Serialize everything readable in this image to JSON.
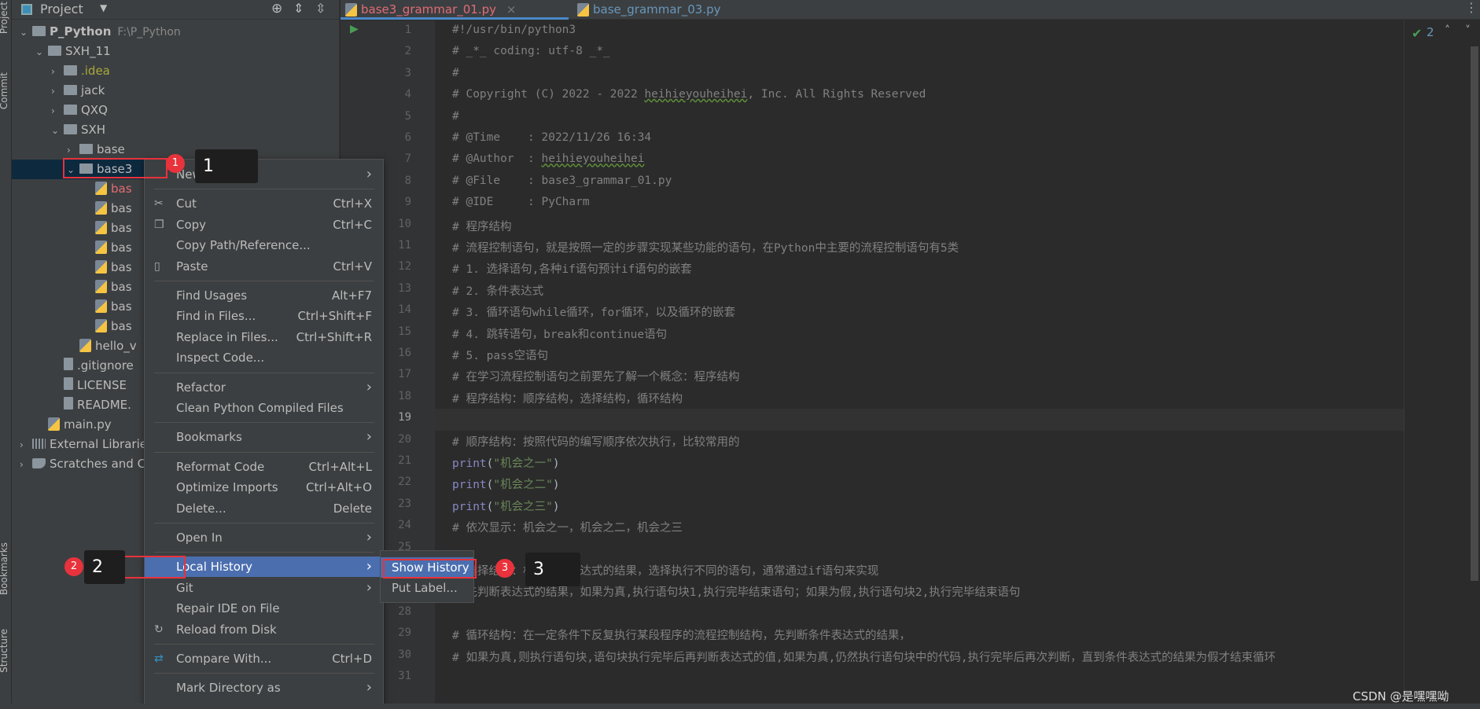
{
  "left_stripe": [
    "Project",
    "Commit",
    "Bookmarks",
    "Structure"
  ],
  "project_panel": {
    "title": "Project",
    "toolbar_icons": [
      "locate-icon",
      "expand-all-icon",
      "collapse-all-icon",
      "gear-icon",
      "minimize-icon"
    ],
    "tree": [
      {
        "label": "P_Python",
        "hint": "F:\\P_Python",
        "level": 0,
        "type": "folder",
        "expanded": true,
        "bold": true
      },
      {
        "label": "SXH_11",
        "level": 1,
        "type": "folder",
        "expanded": true
      },
      {
        "label": ".idea",
        "level": 2,
        "type": "folder",
        "expanded": false,
        "color": "#a9a93c"
      },
      {
        "label": "jack",
        "level": 2,
        "type": "folder",
        "expanded": false
      },
      {
        "label": "QXQ",
        "level": 2,
        "type": "folder",
        "expanded": false
      },
      {
        "label": "SXH",
        "level": 2,
        "type": "folder",
        "expanded": true
      },
      {
        "label": "base",
        "level": 3,
        "type": "folder",
        "expanded": false
      },
      {
        "label": "base3",
        "level": 3,
        "type": "folder",
        "expanded": true,
        "selected": true
      },
      {
        "label": "bas",
        "level": 4,
        "type": "py",
        "color": "#e06c75"
      },
      {
        "label": "bas",
        "level": 4,
        "type": "py"
      },
      {
        "label": "bas",
        "level": 4,
        "type": "py"
      },
      {
        "label": "bas",
        "level": 4,
        "type": "py"
      },
      {
        "label": "bas",
        "level": 4,
        "type": "py"
      },
      {
        "label": "bas",
        "level": 4,
        "type": "py"
      },
      {
        "label": "bas",
        "level": 4,
        "type": "py"
      },
      {
        "label": "bas",
        "level": 4,
        "type": "py"
      },
      {
        "label": "hello_v",
        "level": 3,
        "type": "py"
      },
      {
        "label": ".gitignore",
        "level": 2,
        "type": "file"
      },
      {
        "label": "LICENSE",
        "level": 2,
        "type": "file"
      },
      {
        "label": "README.",
        "level": 2,
        "type": "md"
      },
      {
        "label": "main.py",
        "level": 1,
        "type": "py"
      },
      {
        "label": "External Librarie",
        "level": 0,
        "type": "lib",
        "expanded": false
      },
      {
        "label": "Scratches and C",
        "level": 0,
        "type": "scratch",
        "expanded": false
      }
    ]
  },
  "tabs": [
    {
      "label": "base3_grammar_01.py",
      "active": true,
      "color": "#e06c75"
    },
    {
      "label": "base_grammar_03.py",
      "active": false,
      "color": "#6897bb"
    }
  ],
  "inspections": {
    "count": "2",
    "color": "#499c54"
  },
  "code_lines": [
    "#!/usr/bin/python3",
    "# _*_ coding: utf-8 _*_",
    "#",
    "# Copyright (C) 2022 - 2022 heihieyouheihei, Inc. All Rights Reserved",
    "#",
    "# @Time    : 2022/11/26 16:34",
    "# @Author  : heihieyouheihei",
    "# @File    : base3_grammar_01.py",
    "# @IDE     : PyCharm",
    "# 程序结构",
    "# 流程控制语句，就是按照一定的步骤实现某些功能的语句，在Python中主要的流程控制语句有5类",
    "# 1. 选择语句,各种if语句预计if语句的嵌套",
    "# 2. 条件表达式",
    "# 3. 循环语句while循环，for循环，以及循环的嵌套",
    "# 4. 跳转语句，break和continue语句",
    "# 5. pass空语句",
    "# 在学习流程控制语句之前要先了解一个概念：程序结构",
    "# 程序结构：顺序结构，选择结构，循环结构",
    "",
    "# 顺序结构：按照代码的编写顺序依次执行，比较常用的",
    "print(\"机会之一\")",
    "print(\"机会之二\")",
    "print(\"机会之三\")",
    "# 依次显示：机会之一，机会之二，机会之三",
    "",
    "# 选择结构：根据条件表达式的结果，选择执行不同的语句，通常通过if语句来实现",
    "# 先判断表达式的结果，如果为真,执行语句块1,执行完毕结束语句；如果为假,执行语句块2,执行完毕结束语句",
    "",
    "# 循环结构：在一定条件下反复执行某段程序的流程控制结构，先判断条件表达式的结果，",
    "# 如果为真,则执行语句块,语句块执行完毕后再判断表达式的值,如果为真,仍然执行语句块中的代码,执行完毕后再次判断，直到条件表达式的结果为假才结束循环",
    ""
  ],
  "current_line": 19,
  "context_menu": [
    {
      "label": "New",
      "submenu": true,
      "sep": true
    },
    {
      "label": "Cut",
      "shortcut": "Ctrl+X",
      "icon": "cut-icon",
      "glyph": "✂"
    },
    {
      "label": "Copy",
      "shortcut": "Ctrl+C",
      "icon": "copy-icon",
      "glyph": "❐"
    },
    {
      "label": "Copy Path/Reference..."
    },
    {
      "label": "Paste",
      "shortcut": "Ctrl+V",
      "icon": "paste-icon",
      "glyph": "▯",
      "sep": true
    },
    {
      "label": "Find Usages",
      "shortcut": "Alt+F7"
    },
    {
      "label": "Find in Files...",
      "shortcut": "Ctrl+Shift+F"
    },
    {
      "label": "Replace in Files...",
      "shortcut": "Ctrl+Shift+R"
    },
    {
      "label": "Inspect Code...",
      "sep": true
    },
    {
      "label": "Refactor",
      "submenu": true
    },
    {
      "label": "Clean Python Compiled Files",
      "sep": true
    },
    {
      "label": "Bookmarks",
      "submenu": true,
      "sep": true
    },
    {
      "label": "Reformat Code",
      "shortcut": "Ctrl+Alt+L"
    },
    {
      "label": "Optimize Imports",
      "shortcut": "Ctrl+Alt+O"
    },
    {
      "label": "Delete...",
      "shortcut": "Delete",
      "sep": true
    },
    {
      "label": "Open In",
      "submenu": true,
      "sep": true
    },
    {
      "label": "Local History",
      "submenu": true,
      "highlighted": true
    },
    {
      "label": "Git",
      "submenu": true
    },
    {
      "label": "Repair IDE on File"
    },
    {
      "label": "Reload from Disk",
      "icon": "reload-icon",
      "glyph": "↻",
      "sep": true
    },
    {
      "label": "Compare With...",
      "shortcut": "Ctrl+D",
      "icon": "compare-icon",
      "glyph": "⇄",
      "sep": true
    },
    {
      "label": "Mark Directory as",
      "submenu": true
    }
  ],
  "submenu": [
    {
      "label": "Show History",
      "highlighted": true
    },
    {
      "label": "Put Label..."
    }
  ],
  "annotations": [
    {
      "number": "1"
    },
    {
      "number": "2"
    },
    {
      "number": "3"
    }
  ],
  "watermark": "CSDN @是嘿嘿呦"
}
